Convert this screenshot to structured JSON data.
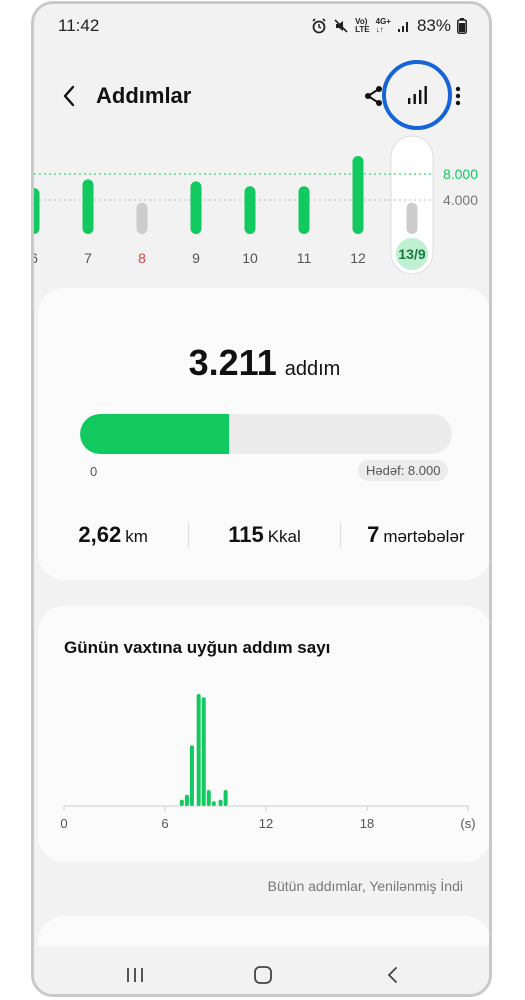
{
  "status": {
    "time": "11:42",
    "battery": "83%",
    "network_top": "Vo)",
    "network_bottom": "LTE",
    "data_top": "4G+",
    "data_bottom": "↓↑"
  },
  "header": {
    "title": "Addımlar"
  },
  "top_chart": {
    "labels": [
      "6",
      "7",
      "8",
      "9",
      "10",
      "11",
      "12",
      "13/9"
    ],
    "values": [
      4700,
      5600,
      3200,
      5400,
      4900,
      4900,
      8000,
      3211
    ],
    "label_colors": [
      "#555555",
      "#555555",
      "#d64242",
      "#555555",
      "#555555",
      "#555555",
      "#555555",
      "#1a7a3f"
    ],
    "goal_label": "8.000",
    "mid_label": "4.000",
    "goal_color": "#12c95f"
  },
  "summary": {
    "steps": "3.211",
    "unit": "addım",
    "progress": 0.4,
    "zero_label": "0",
    "goal_text": "Hədəf: 8.000",
    "distance_value": "2,62",
    "distance_unit": "km",
    "calories_value": "115",
    "calories_unit": "Kkal",
    "floors_value": "7",
    "floors_unit": "mərtəbələr"
  },
  "hourly": {
    "title": "Günün vaxtına uyğun addım sayı",
    "x_ticks": [
      "0",
      "6",
      "12",
      "18",
      "(s)"
    ]
  },
  "chart_data": {
    "type": "bar",
    "title": "Günün vaxtına uyğun addım sayı",
    "xlabel": "(s)",
    "x": [
      7.0,
      7.3,
      7.6,
      8.0,
      8.3,
      8.6,
      8.9,
      9.3,
      9.6,
      10.0
    ],
    "values": [
      40,
      70,
      380,
      700,
      680,
      100,
      30,
      40,
      100,
      0
    ],
    "xlim": [
      0,
      24
    ],
    "ylim": [
      0,
      750
    ],
    "color": "#12c95f"
  },
  "footer": {
    "text": "Bütün addımlar, Yenilənmiş İndi"
  },
  "colors": {
    "accent": "#12c95f",
    "highlight_ring": "#1565d8"
  }
}
